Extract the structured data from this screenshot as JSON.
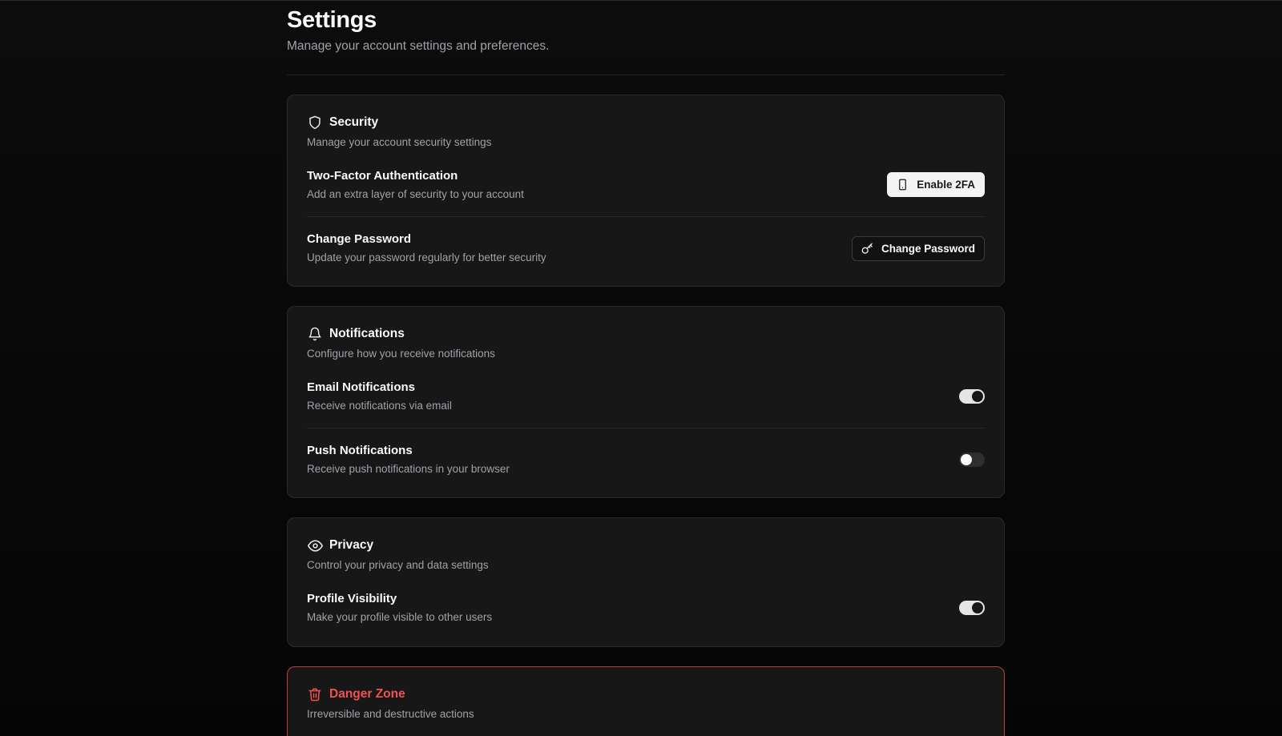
{
  "page": {
    "title": "Settings",
    "subtitle": "Manage your account settings and preferences."
  },
  "security": {
    "title": "Security",
    "description": "Manage your account security settings",
    "icon": "shield-icon",
    "two_factor": {
      "title": "Two-Factor Authentication",
      "description": "Add an extra layer of security to your account",
      "button_label": "Enable 2FA",
      "button_icon": "smartphone-icon"
    },
    "change_password": {
      "title": "Change Password",
      "description": "Update your password regularly for better security",
      "button_label": "Change Password",
      "button_icon": "key-icon"
    }
  },
  "notifications": {
    "title": "Notifications",
    "description": "Configure how you receive notifications",
    "icon": "bell-icon",
    "email": {
      "title": "Email Notifications",
      "description": "Receive notifications via email",
      "enabled": true
    },
    "push": {
      "title": "Push Notifications",
      "description": "Receive push notifications in your browser",
      "enabled": false
    }
  },
  "privacy": {
    "title": "Privacy",
    "description": "Control your privacy and data settings",
    "icon": "eye-icon",
    "profile_visibility": {
      "title": "Profile Visibility",
      "description": "Make your profile visible to other users",
      "enabled": true
    }
  },
  "danger_zone": {
    "title": "Danger Zone",
    "description": "Irreversible and destructive actions",
    "icon": "trash-icon",
    "accent_color": "#f05252"
  },
  "colors": {
    "background": "#0a0a0a",
    "card": "#171717",
    "muted_text": "#a1a1aa",
    "danger": "#f05252"
  }
}
